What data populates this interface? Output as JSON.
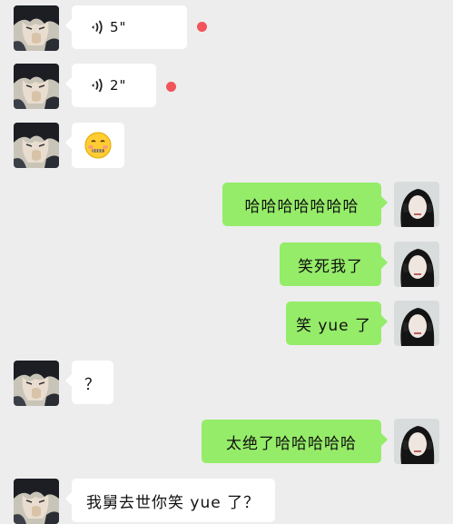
{
  "colors": {
    "background": "#ededed",
    "incoming_bubble": "#ffffff",
    "outgoing_bubble": "#95ec69",
    "unread_dot": "#f2545b"
  },
  "messages": [
    {
      "side": "incoming",
      "type": "voice",
      "duration": "5\"",
      "unread": true
    },
    {
      "side": "incoming",
      "type": "voice",
      "duration": "2\"",
      "unread": true
    },
    {
      "side": "incoming",
      "type": "emoji",
      "icon": "zipper-mouth-face-emoji"
    },
    {
      "side": "outgoing",
      "type": "text",
      "text": "哈哈哈哈哈哈哈"
    },
    {
      "side": "outgoing",
      "type": "text",
      "text": "笑死我了"
    },
    {
      "side": "outgoing",
      "type": "text",
      "text": "笑 yue 了"
    },
    {
      "side": "incoming",
      "type": "text",
      "text": "？"
    },
    {
      "side": "outgoing",
      "type": "text",
      "text": "太绝了哈哈哈哈哈"
    },
    {
      "side": "incoming",
      "type": "text",
      "text": "我舅去世你笑 yue 了？"
    }
  ]
}
